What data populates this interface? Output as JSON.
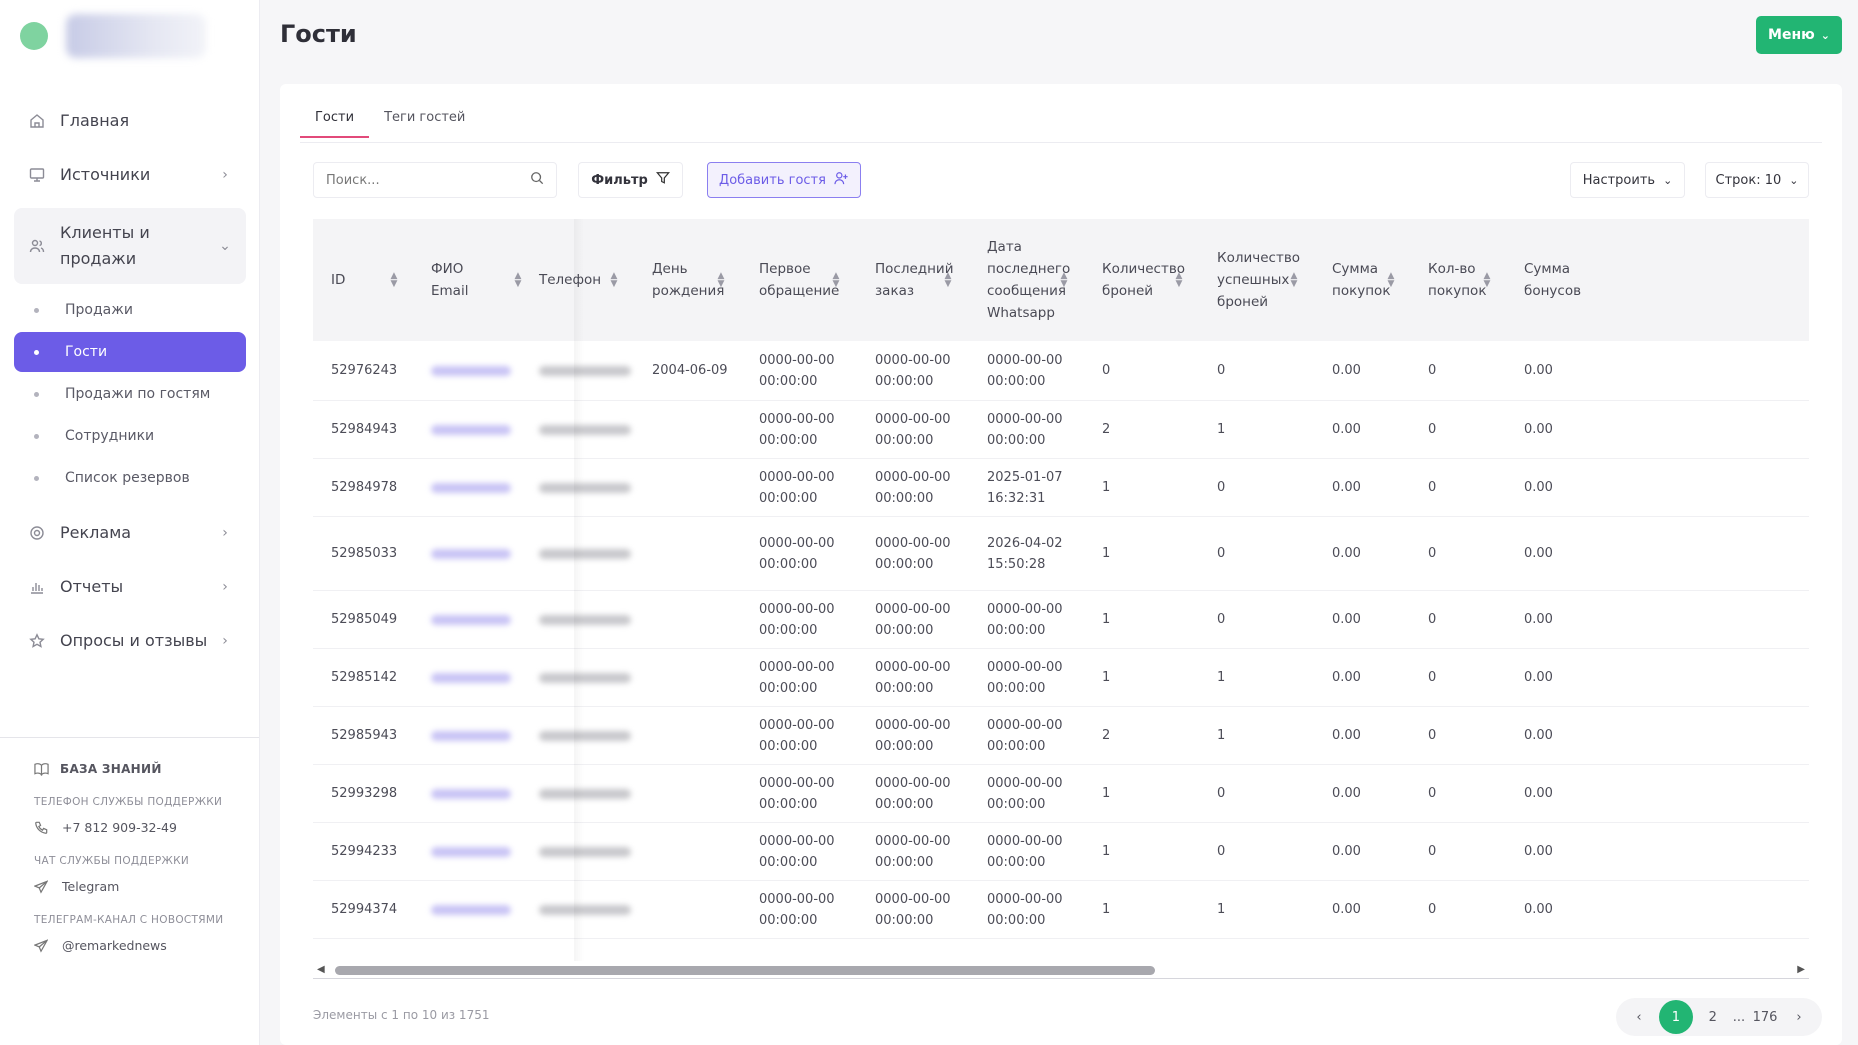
{
  "sidebar": {
    "nav": [
      {
        "label": "Главная",
        "icon": "home-icon"
      },
      {
        "label": "Источники",
        "icon": "monitor-icon"
      },
      {
        "label": "Клиенты и продажи",
        "icon": "users-icon"
      },
      {
        "label": "Реклама",
        "icon": "target-icon"
      },
      {
        "label": "Отчеты",
        "icon": "bar-chart-icon"
      },
      {
        "label": "Опросы и отзывы",
        "icon": "star-icon"
      }
    ],
    "sub": [
      "Продажи",
      "Гости",
      "Продажи по гостям",
      "Сотрудники",
      "Список резервов"
    ],
    "active_sub": "Гости",
    "knowledge_base": "БАЗА ЗНАНИЙ",
    "support_phone_caption": "ТЕЛЕФОН СЛУЖБЫ ПОДДЕРЖКИ",
    "support_phone": "+7 812 909-32-49",
    "support_chat_caption": "ЧАТ СЛУЖБЫ ПОДДЕРЖКИ",
    "support_chat": "Telegram",
    "news_caption": "ТЕЛЕГРАМ-КАНАЛ С НОВОСТЯМИ",
    "news_channel": "@remarkednews"
  },
  "header": {
    "title": "Гости",
    "menu_label": "Меню",
    "accent": "#22b573"
  },
  "tabs": [
    "Гости",
    "Теги гостей"
  ],
  "toolbar": {
    "search_placeholder": "Поиск...",
    "filter_label": "Фильтр",
    "add_label": "Добавить гостя",
    "setup_label": "Настроить",
    "rows_label": "Строк: 10"
  },
  "table": {
    "headers": {
      "id": "ID",
      "fio": "ФИО",
      "email": "Email",
      "phone": "Телефон",
      "birthday": "День рождения",
      "first_contact": "Первое обращение",
      "last_order": "Последний заказ",
      "last_whatsapp": "Дата последнего сообщения Whatsapp",
      "bookings": "Количество броней",
      "successful_bookings": "Количество успешных броней",
      "purchase_sum": "Сумма покупок",
      "purchase_count": "Кол-во покупок",
      "bonus_sum": "Сумма бонусов"
    },
    "rows": [
      {
        "id": "52976243",
        "birthday": "2004-06-09",
        "first1": "0000-00-00",
        "first2": "00:00:00",
        "last1": "0000-00-00",
        "last2": "00:00:00",
        "wa1": "0000-00-00",
        "wa2": "00:00:00",
        "bookings": "0",
        "succ": "0",
        "sum": "0.00",
        "cnt": "0",
        "bonus": "0.00"
      },
      {
        "id": "52984943",
        "birthday": "",
        "first1": "0000-00-00",
        "first2": "00:00:00",
        "last1": "0000-00-00",
        "last2": "00:00:00",
        "wa1": "0000-00-00",
        "wa2": "00:00:00",
        "bookings": "2",
        "succ": "1",
        "sum": "0.00",
        "cnt": "0",
        "bonus": "0.00"
      },
      {
        "id": "52984978",
        "birthday": "",
        "first1": "0000-00-00",
        "first2": "00:00:00",
        "last1": "0000-00-00",
        "last2": "00:00:00",
        "wa1": "2025-01-07",
        "wa2": "16:32:31",
        "bookings": "1",
        "succ": "0",
        "sum": "0.00",
        "cnt": "0",
        "bonus": "0.00"
      },
      {
        "id": "52985033",
        "birthday": "",
        "first1": "0000-00-00",
        "first2": "00:00:00",
        "last1": "0000-00-00",
        "last2": "00:00:00",
        "wa1": "2026-04-02",
        "wa2": "15:50:28",
        "bookings": "1",
        "succ": "0",
        "sum": "0.00",
        "cnt": "0",
        "bonus": "0.00"
      },
      {
        "id": "52985049",
        "birthday": "",
        "first1": "0000-00-00",
        "first2": "00:00:00",
        "last1": "0000-00-00",
        "last2": "00:00:00",
        "wa1": "0000-00-00",
        "wa2": "00:00:00",
        "bookings": "1",
        "succ": "0",
        "sum": "0.00",
        "cnt": "0",
        "bonus": "0.00"
      },
      {
        "id": "52985142",
        "birthday": "",
        "first1": "0000-00-00",
        "first2": "00:00:00",
        "last1": "0000-00-00",
        "last2": "00:00:00",
        "wa1": "0000-00-00",
        "wa2": "00:00:00",
        "bookings": "1",
        "succ": "1",
        "sum": "0.00",
        "cnt": "0",
        "bonus": "0.00"
      },
      {
        "id": "52985943",
        "birthday": "",
        "first1": "0000-00-00",
        "first2": "00:00:00",
        "last1": "0000-00-00",
        "last2": "00:00:00",
        "wa1": "0000-00-00",
        "wa2": "00:00:00",
        "bookings": "2",
        "succ": "1",
        "sum": "0.00",
        "cnt": "0",
        "bonus": "0.00"
      },
      {
        "id": "52993298",
        "birthday": "",
        "first1": "0000-00-00",
        "first2": "00:00:00",
        "last1": "0000-00-00",
        "last2": "00:00:00",
        "wa1": "0000-00-00",
        "wa2": "00:00:00",
        "bookings": "1",
        "succ": "0",
        "sum": "0.00",
        "cnt": "0",
        "bonus": "0.00"
      },
      {
        "id": "52994233",
        "birthday": "",
        "first1": "0000-00-00",
        "first2": "00:00:00",
        "last1": "0000-00-00",
        "last2": "00:00:00",
        "wa1": "0000-00-00",
        "wa2": "00:00:00",
        "bookings": "1",
        "succ": "0",
        "sum": "0.00",
        "cnt": "0",
        "bonus": "0.00"
      },
      {
        "id": "52994374",
        "birthday": "",
        "first1": "0000-00-00",
        "first2": "00:00:00",
        "last1": "0000-00-00",
        "last2": "00:00:00",
        "wa1": "0000-00-00",
        "wa2": "00:00:00",
        "bookings": "1",
        "succ": "1",
        "sum": "0.00",
        "cnt": "0",
        "bonus": "0.00"
      }
    ]
  },
  "footer": {
    "info": "Элементы с 1 по 10 из 1751",
    "pages": [
      "1",
      "2",
      "...",
      "176"
    ],
    "current_page": "1"
  }
}
